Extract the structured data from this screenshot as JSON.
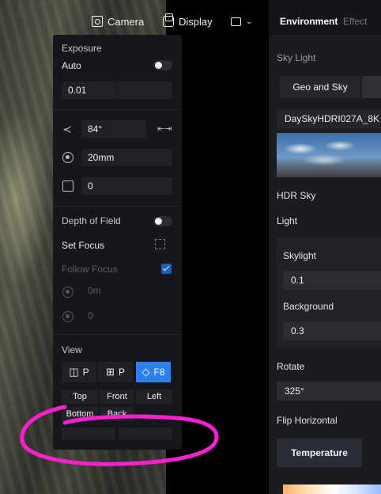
{
  "toolbar": {
    "camera_label": "Camera",
    "display_label": "Display"
  },
  "camera_panel": {
    "exposure": {
      "title": "Exposure",
      "auto_label": "Auto",
      "value": "0.01"
    },
    "fov": {
      "angle": "84°",
      "focal_length": "20mm",
      "extra": "0"
    },
    "dof": {
      "title": "Depth of Field",
      "set_focus_label": "Set Focus",
      "follow_focus_label": "Follow Focus",
      "distance": "0m",
      "aperture": "0"
    },
    "view": {
      "title": "View",
      "modes": [
        {
          "label": "P",
          "active": false
        },
        {
          "label": "P",
          "active": false
        },
        {
          "label": "F8",
          "active": true
        }
      ],
      "buttons": [
        "Top",
        "Front",
        "Left",
        "Bottom",
        "Back"
      ]
    }
  },
  "right_panel": {
    "tabs": [
      "Environment",
      "Effect"
    ],
    "sky_light_title": "Sky Light",
    "geo_and_sky_label": "Geo and Sky",
    "hdri_name": "DaySkyHDRI027A_8K",
    "hdr_sky_label": "HDR Sky",
    "light_label": "Light",
    "skylight_label": "Skylight",
    "skylight_value": "0.1",
    "background_label": "Background",
    "background_value": "0.3",
    "rotate_label": "Rotate",
    "rotate_value": "325°",
    "flip_label": "Flip Horizontal",
    "temperature_label": "Temperature"
  },
  "colors": {
    "accent": "#2c7ff0",
    "annotation": "#ff1fd0"
  },
  "icons": [
    "camera-icon",
    "display-icon",
    "screen-settings-icon",
    "chevron-down-icon",
    "fov-angle-icon",
    "fit-width-icon",
    "focus-target-icon",
    "lens-icon",
    "aperture-icon",
    "perspective-icon",
    "grid-icon",
    "orthographic-icon"
  ]
}
